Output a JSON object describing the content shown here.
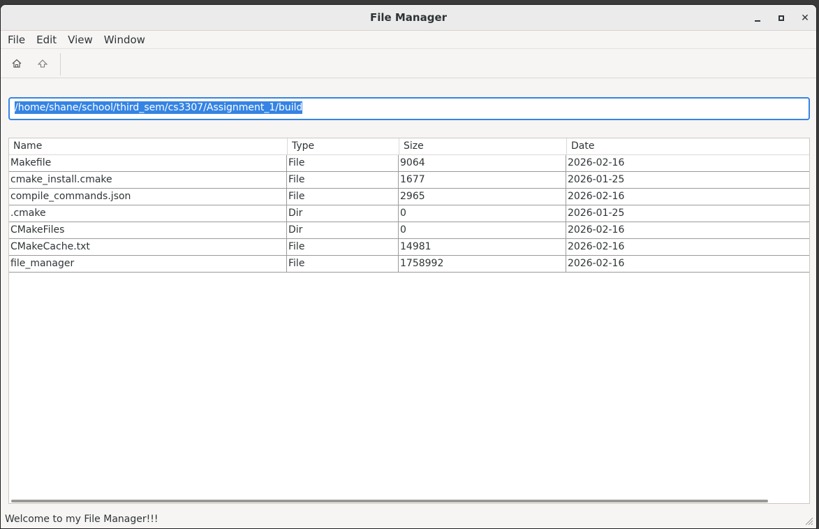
{
  "window": {
    "title": "File Manager",
    "minimize_icon": "minimize-icon",
    "maximize_icon": "maximize-icon",
    "close_label": "✕"
  },
  "menu": [
    "File",
    "Edit",
    "View",
    "Window"
  ],
  "toolbar": {
    "home_icon": "home-icon",
    "up_icon": "go-up-icon"
  },
  "path": {
    "value": "/home/shane/school/third_sem/cs3307/Assignment_1/build"
  },
  "table": {
    "columns": [
      "Name",
      "Type",
      "Size",
      "Date"
    ],
    "rows": [
      [
        "Makefile",
        "File",
        "9064",
        "2026-02-16"
      ],
      [
        "cmake_install.cmake",
        "File",
        "1677",
        "2026-01-25"
      ],
      [
        "compile_commands.json",
        "File",
        "2965",
        "2026-02-16"
      ],
      [
        ".cmake",
        "Dir",
        "0",
        "2026-01-25"
      ],
      [
        "CMakeFiles",
        "Dir",
        "0",
        "2026-02-16"
      ],
      [
        "CMakeCache.txt",
        "File",
        "14981",
        "2026-02-16"
      ],
      [
        "file_manager",
        "File",
        "1758992",
        "2026-02-16"
      ]
    ]
  },
  "status": {
    "message": "Welcome to my File Manager!!!"
  },
  "colors": {
    "accent": "#3584e4",
    "window_bg": "#f6f5f4"
  }
}
